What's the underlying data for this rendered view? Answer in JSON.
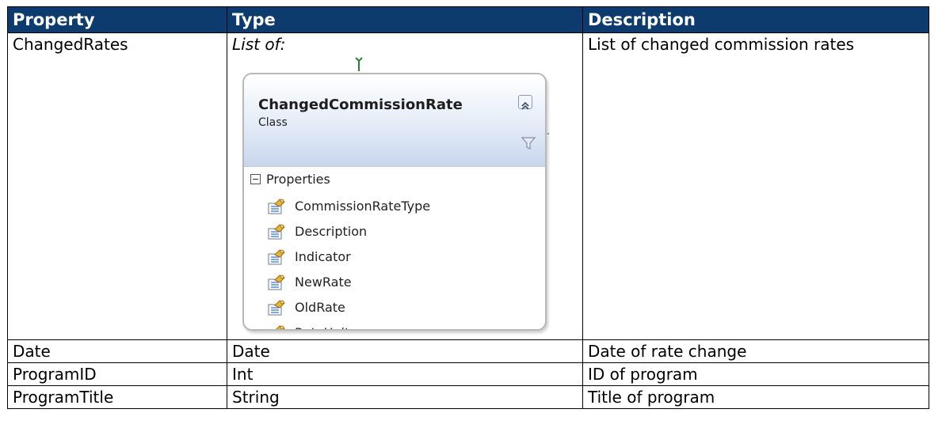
{
  "table": {
    "headers": [
      "Property",
      "Type",
      "Description"
    ],
    "rows": [
      {
        "property": "ChangedRates",
        "type": "List of:",
        "description": "List of changed commission rates"
      },
      {
        "property": "Date",
        "type": "Date",
        "description": "Date of rate change"
      },
      {
        "property": "ProgramID",
        "type": "Int",
        "description": "ID of program"
      },
      {
        "property": "ProgramTitle",
        "type": "String",
        "description": "Title of program"
      }
    ]
  },
  "class_diagram": {
    "name": "ChangedCommissionRate",
    "kind": "Class",
    "section": "Properties",
    "properties": [
      "CommissionRateType",
      "Description",
      "Indicator",
      "NewRate",
      "OldRate",
      "RateUnit"
    ],
    "icons": {
      "collapse": "double-chevron-up-icon",
      "filter": "filter-icon",
      "section_toggle": "collapse-minus-icon",
      "property": "property-icon"
    },
    "colors": {
      "connector": "#2e7d32",
      "header_gradient_end": "#c8d6ec",
      "border": "#b8b8b8"
    }
  },
  "colors": {
    "header_bg": "#0d3b6e",
    "header_text": "#ffffff"
  }
}
